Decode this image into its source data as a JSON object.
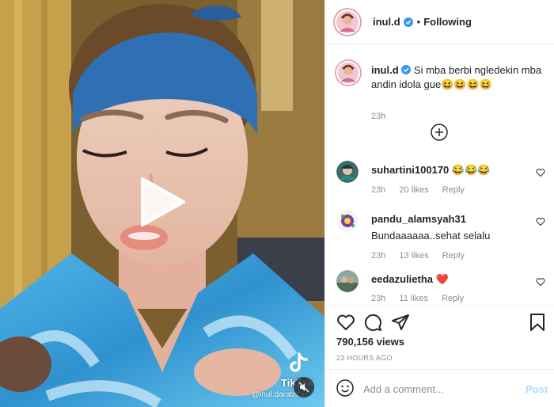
{
  "post": {
    "username": "inul.d",
    "follow_label": "Following",
    "separator": "•",
    "verified": true
  },
  "caption": {
    "username": "inul.d",
    "text": "Si mba berbi ngledekin mba andin idola gue😆😆😆😆",
    "time": "23h"
  },
  "comments": [
    {
      "username": "suhartini100170",
      "text": "😂😂😂",
      "time": "23h",
      "likes": "20 likes",
      "reply": "Reply"
    },
    {
      "username": "pandu_alamsyah31",
      "text": "Bundaaaaaa..sehat selalu",
      "time": "23h",
      "likes": "13 likes",
      "reply": "Reply"
    },
    {
      "username": "eedazulietha",
      "text": "❤️",
      "time": "23h",
      "likes": "11 likes",
      "reply": "Reply"
    }
  ],
  "stats": {
    "views": "790,156 views",
    "time_ago": "23 HOURS AGO"
  },
  "add_comment": {
    "placeholder": "Add a comment...",
    "post_label": "Post"
  },
  "video": {
    "watermark": "TikTok",
    "watermark_user": "@inul.daratista"
  },
  "colors": {
    "verified_blue": "#3897f0",
    "post_disabled": "#b3dbff",
    "comment_heart": "#ed4956",
    "headband": "#2f6fb3"
  },
  "icons": [
    "verified-icon",
    "plus-circle-icon",
    "heart-outline-icon",
    "comment-icon",
    "share-icon",
    "bookmark-icon",
    "emoji-icon",
    "play-icon",
    "mute-icon",
    "tiktok-icon"
  ]
}
